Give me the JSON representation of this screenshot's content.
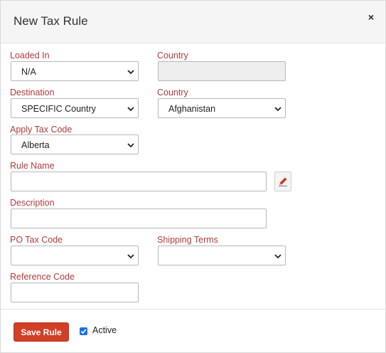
{
  "dialog": {
    "title": "New Tax Rule",
    "close_symbol": "×"
  },
  "fields": {
    "loaded_in": {
      "label": "Loaded In",
      "value": "N/A"
    },
    "country_1": {
      "label": "Country",
      "value": ""
    },
    "destination": {
      "label": "Destination",
      "value": "SPECIFIC Country"
    },
    "country_2": {
      "label": "Country",
      "value": "Afghanistan"
    },
    "apply_tax_code": {
      "label": "Apply Tax Code",
      "value": "Alberta"
    },
    "rule_name": {
      "label": "Rule Name",
      "value": ""
    },
    "description": {
      "label": "Description",
      "value": ""
    },
    "po_tax_code": {
      "label": "PO Tax Code",
      "value": ""
    },
    "shipping_terms": {
      "label": "Shipping Terms",
      "value": ""
    },
    "reference_code": {
      "label": "Reference Code",
      "value": ""
    }
  },
  "footer": {
    "save_label": "Save Rule",
    "active_label": "Active",
    "active_checked": true
  },
  "icons": {
    "close": "close-icon",
    "chevron": "chevron-down-icon",
    "edit": "pencil-icon",
    "checkbox": "checkmark-icon"
  },
  "colors": {
    "label": "#b03c3c",
    "save_button": "#d13f26",
    "checkbox": "#1a73e8"
  }
}
